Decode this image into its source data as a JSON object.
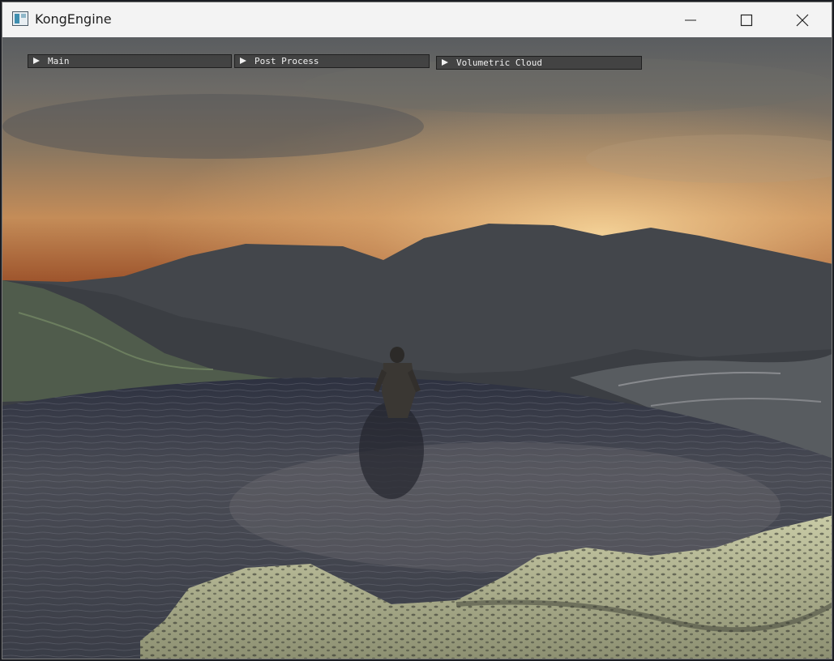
{
  "window": {
    "title": "KongEngine",
    "controls": {
      "minimize_icon": "minimize-icon",
      "maximize_icon": "maximize-icon",
      "close_icon": "close-icon"
    }
  },
  "panels": [
    {
      "label": "Main",
      "expanded": false
    },
    {
      "label": "Post Process",
      "expanded": false
    },
    {
      "label": "Volumetric Cloud",
      "expanded": false
    }
  ],
  "colors": {
    "title_bar": "#f3f3f3",
    "panel_header": "#3c3c3c",
    "panel_text": "#f0f0f0",
    "sky_top": "#5e6060",
    "sky_horizon": "#f2c98a"
  }
}
